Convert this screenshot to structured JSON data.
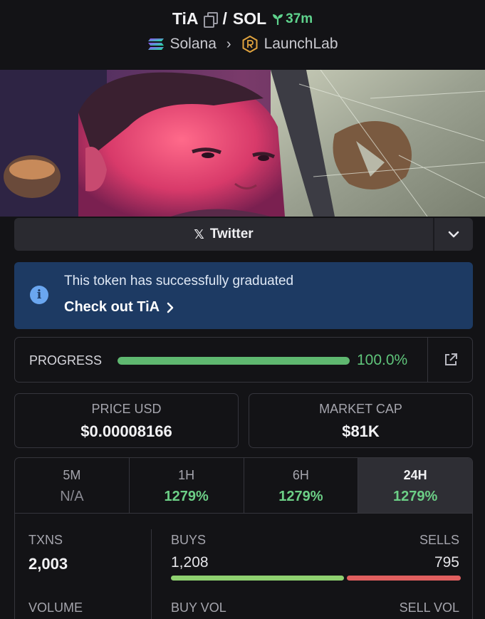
{
  "header": {
    "base_token": "TiA",
    "separator": "/",
    "quote_token": "SOL",
    "age": "37m",
    "chain": "Solana",
    "dex": "LaunchLab"
  },
  "social": {
    "twitter_label": "Twitter"
  },
  "alert": {
    "message": "This token has successfully graduated",
    "link_label": "Check out TiA"
  },
  "progress": {
    "label": "PROGRESS",
    "value_text": "100.0%",
    "fraction": 1.0
  },
  "stats": {
    "price_label": "PRICE USD",
    "price_value": "$0.00008166",
    "mcap_label": "MARKET CAP",
    "mcap_value": "$81K"
  },
  "timeframes": [
    {
      "label": "5M",
      "value": "N/A"
    },
    {
      "label": "1H",
      "value": "1279%"
    },
    {
      "label": "6H",
      "value": "1279%"
    },
    {
      "label": "24H",
      "value": "1279%"
    }
  ],
  "txns": {
    "txns_label": "TXNS",
    "txns_value": "2,003",
    "buys_label": "BUYS",
    "buys_value": "1,208",
    "sells_label": "SELLS",
    "sells_value": "795",
    "buy_fraction": 0.603,
    "volume_label": "VOLUME",
    "buy_vol_label": "BUY VOL",
    "sell_vol_label": "SELL VOL"
  },
  "colors": {
    "background": "#131316",
    "accent_green": "#5fc47a",
    "alert_bg": "#1d3a63",
    "sell_red": "#e05f5f"
  },
  "icons": [
    "copy-icon",
    "sprout-icon",
    "solana-icon",
    "chevron-right-icon",
    "launchlab-icon",
    "x-logo-icon",
    "chevron-down-icon",
    "info-icon",
    "external-link-icon"
  ]
}
